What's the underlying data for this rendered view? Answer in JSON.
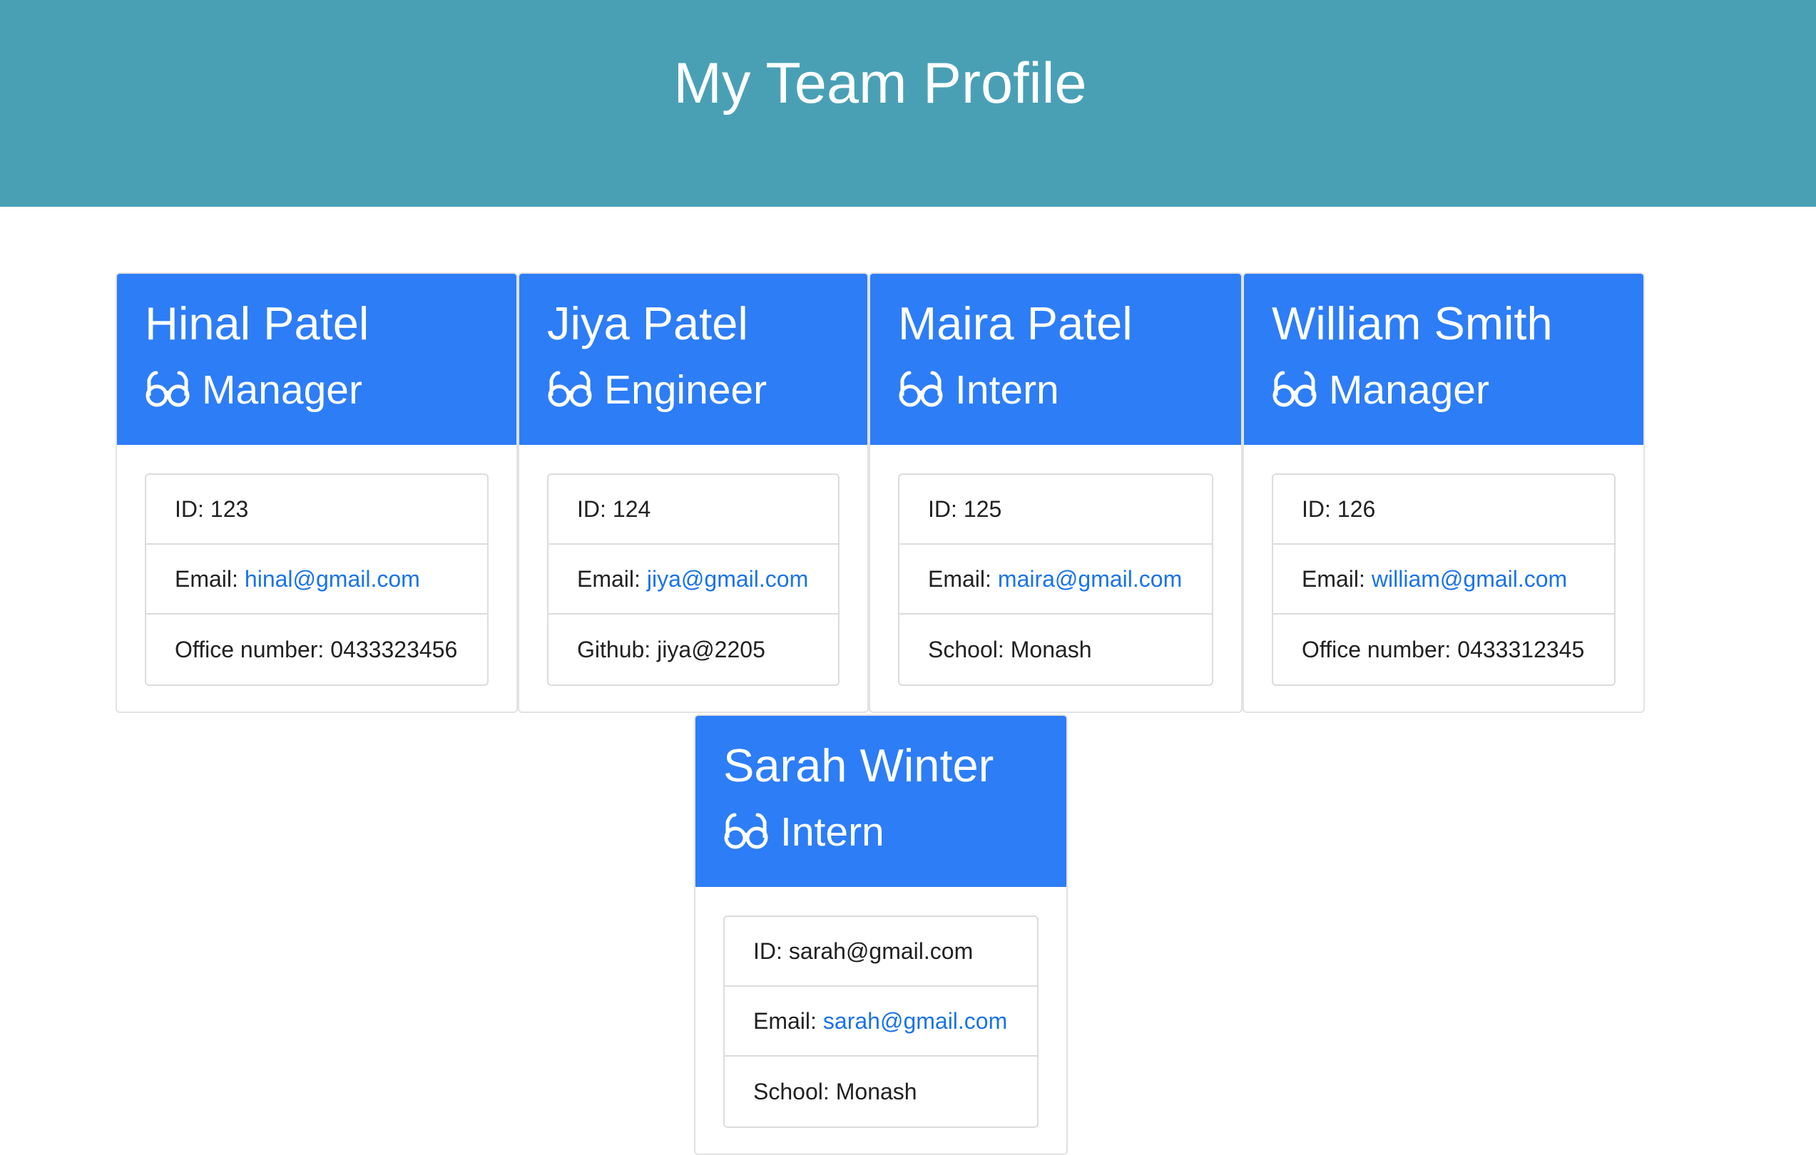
{
  "header": {
    "title": "My Team Profile",
    "background": "#49a0b5"
  },
  "colors": {
    "card_header": "#2d7df6",
    "link": "#1a73e8"
  },
  "icons": {
    "role_icon": "glasses-icon"
  },
  "cards": [
    {
      "name": "Hinal Patel",
      "role": "Manager",
      "id_label": "ID:",
      "id": "123",
      "email_label": "Email:",
      "email": "hinal@gmail.com",
      "extra_label": "Office number:",
      "extra": "0433323456"
    },
    {
      "name": "Jiya Patel",
      "role": "Engineer",
      "id_label": "ID:",
      "id": "124",
      "email_label": "Email:",
      "email": "jiya@gmail.com",
      "extra_label": "Github:",
      "extra": "jiya@2205"
    },
    {
      "name": "Maira Patel",
      "role": "Intern",
      "id_label": "ID:",
      "id": "125",
      "email_label": "Email:",
      "email": "maira@gmail.com",
      "extra_label": "School:",
      "extra": "Monash"
    },
    {
      "name": "William Smith",
      "role": "Manager",
      "id_label": "ID:",
      "id": "126",
      "email_label": "Email:",
      "email": "william@gmail.com",
      "extra_label": "Office number:",
      "extra": "0433312345"
    },
    {
      "name": "Sarah Winter",
      "role": "Intern",
      "id_label": "ID:",
      "id": "sarah@gmail.com",
      "email_label": "Email:",
      "email": "sarah@gmail.com",
      "extra_label": "School:",
      "extra": "Monash"
    }
  ]
}
